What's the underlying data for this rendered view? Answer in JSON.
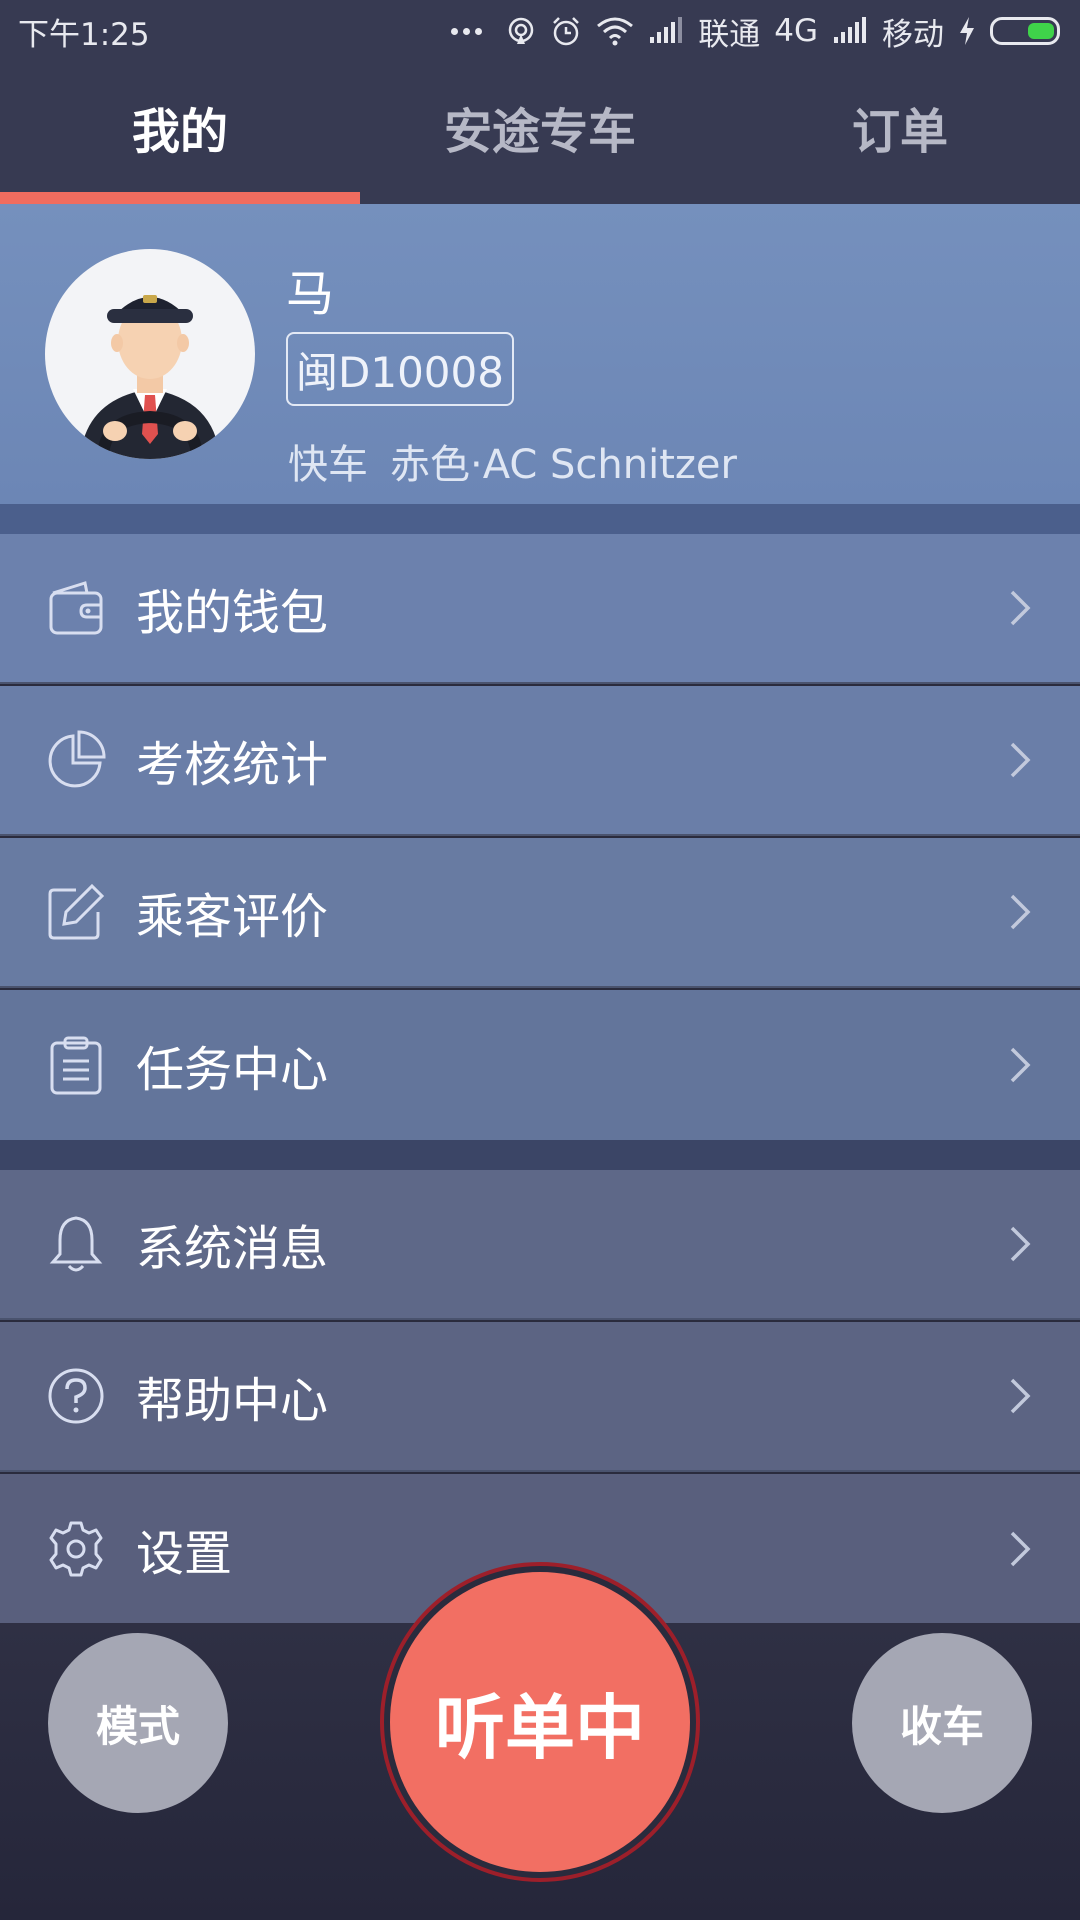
{
  "status_bar": {
    "time": "下午1:25",
    "carrier1": "联通",
    "network1": "4G",
    "carrier2": "移动"
  },
  "tabs": [
    {
      "label": "我的",
      "active": true
    },
    {
      "label": "安途专车",
      "active": false
    },
    {
      "label": "订单",
      "active": false
    }
  ],
  "profile": {
    "name": "马",
    "plate": "闽D10008",
    "car_type": "快车",
    "car_desc": "赤色·AC Schnitzer"
  },
  "menu_group1": [
    {
      "label": "我的钱包",
      "icon": "wallet-icon"
    },
    {
      "label": "考核统计",
      "icon": "pie-chart-icon"
    },
    {
      "label": "乘客评价",
      "icon": "edit-icon"
    },
    {
      "label": "任务中心",
      "icon": "clipboard-icon"
    }
  ],
  "menu_group2": [
    {
      "label": "系统消息",
      "icon": "bell-icon"
    },
    {
      "label": "帮助中心",
      "icon": "help-icon"
    },
    {
      "label": "设置",
      "icon": "gear-icon"
    }
  ],
  "bottom": {
    "mode_label": "模式",
    "main_label": "听单中",
    "off_label": "收车"
  },
  "colors": {
    "accent": "#f26f63",
    "header_bg": "#373a52",
    "profile_bg": "#7590bd",
    "battery": "#3fd34a"
  }
}
